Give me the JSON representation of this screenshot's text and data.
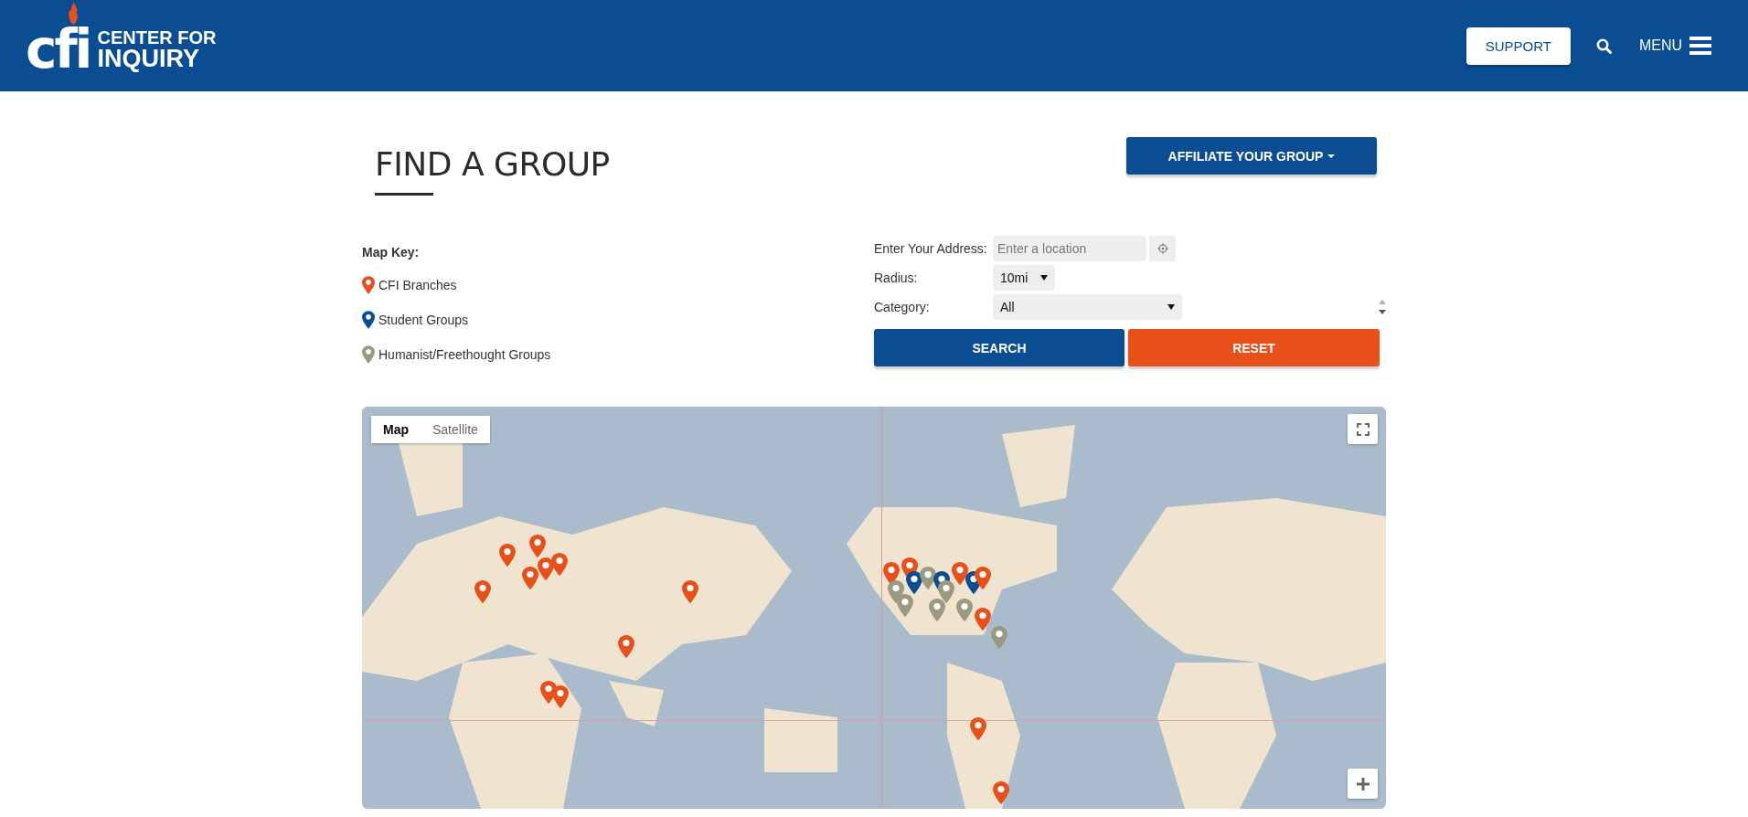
{
  "header": {
    "logo": {
      "mark": "cfi",
      "line_1": "CENTER FOR",
      "line_2": "INQUIRY"
    },
    "support_button": "SUPPORT",
    "menu_label": "MENU"
  },
  "page": {
    "title": "FIND A GROUP",
    "affiliate_button": "AFFILIATE YOUR GROUP"
  },
  "map_key": {
    "title": "Map Key:",
    "items": [
      {
        "label": "CFI Branches",
        "color": "#e8501a"
      },
      {
        "label": "Student Groups",
        "color": "#0a4d92"
      },
      {
        "label": "Humanist/Freethought Groups",
        "color": "#9b9a80"
      }
    ]
  },
  "form": {
    "address_label": "Enter Your Address:",
    "address_placeholder": "Enter a location",
    "radius_label": "Radius:",
    "radius_value": "10mi",
    "category_label": "Category:",
    "category_value": "All",
    "search_button": "SEARCH",
    "reset_button": "RESET"
  },
  "map": {
    "type_tabs": [
      {
        "label": "Map",
        "selected": true
      },
      {
        "label": "Satellite",
        "selected": false
      }
    ]
  }
}
